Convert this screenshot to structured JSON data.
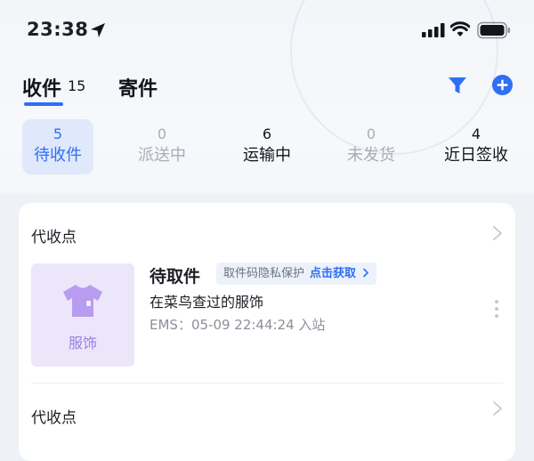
{
  "status_bar": {
    "time": "23:38",
    "icons": [
      "location-arrow-icon",
      "cellular-signal-icon",
      "wifi-icon",
      "battery-icon"
    ]
  },
  "tabs": {
    "receive": {
      "label": "收件",
      "count": "15"
    },
    "send": {
      "label": "寄件"
    },
    "actions": [
      "filter-icon",
      "add-icon"
    ]
  },
  "status_counts": [
    {
      "count": "5",
      "label": "待收件"
    },
    {
      "count": "0",
      "label": "派送中"
    },
    {
      "count": "6",
      "label": "运输中"
    },
    {
      "count": "0",
      "label": "未发货"
    },
    {
      "count": "4",
      "label": "近日签收"
    }
  ],
  "sections": [
    {
      "title": "代收点",
      "package": {
        "thumb_label": "服饰",
        "status": "待取件",
        "privacy_text": "取件码隐私保护",
        "privacy_action": "点击获取",
        "description": "在菜鸟查过的服饰",
        "meta": "EMS：05-09 22:44:24 入站"
      }
    },
    {
      "title": "代收点"
    }
  ],
  "colors": {
    "accent": "#2f6ef5",
    "active_bg": "#dfe9fb",
    "muted_text": "#a8adb6",
    "thumb_bg": "#ece6fb",
    "thumb_accent": "#b89cf0"
  }
}
